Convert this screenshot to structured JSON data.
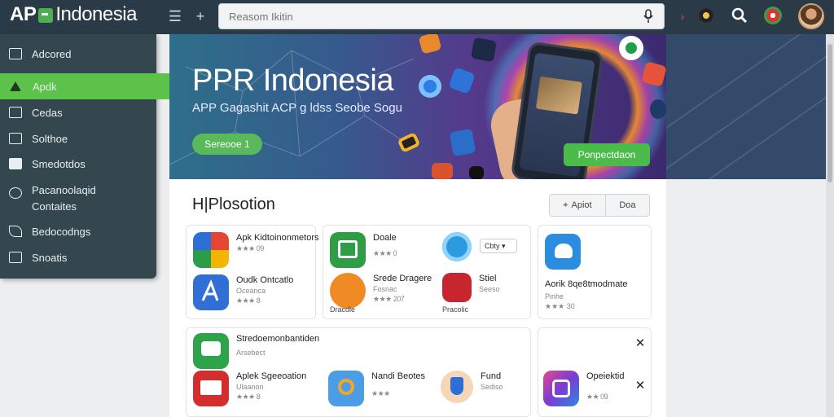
{
  "brand": {
    "prefix": "AP",
    "name": "Indonesia"
  },
  "search": {
    "placeholder": "Reasom Ikitin"
  },
  "sidebar": {
    "items": [
      {
        "label": "Adcored"
      },
      {
        "label": "Apdk"
      },
      {
        "label": "Cedas"
      },
      {
        "label": "Solthoe"
      },
      {
        "label": "Smedotdos"
      },
      {
        "label": "Pacanoolaqid Contaites"
      },
      {
        "label": "Bedocodngs"
      },
      {
        "label": "Snoatis"
      }
    ]
  },
  "banner": {
    "title": "PPR Indonesia",
    "subtitle": "APP Gagashit ACP g ldss Seobe Sogu",
    "left_button": "Sereooe 1",
    "right_button": "Ponpectdaon"
  },
  "content": {
    "title": "H|Plosotion",
    "seg_apply": "Apiot",
    "seg_other": "Doa"
  },
  "apps": [
    {
      "name": "Apk Kidtoinonmetors",
      "meta": "",
      "stars": "★★★ 09"
    },
    {
      "name": "Oudk Ontcatlo",
      "meta": "Oceanca",
      "stars": "★★★ 8"
    },
    {
      "name": "Doale",
      "meta": "",
      "stars": "★★★ 0"
    },
    {
      "name": "Srede Dragere",
      "meta": "Fosnac",
      "stars": "★★★ 207"
    },
    {
      "name": "Dracdle",
      "meta": "",
      "stars": ""
    },
    {
      "name": "Cbty",
      "meta": "",
      "stars": ""
    },
    {
      "name": "Stiel",
      "meta": "Seeso",
      "stars": ""
    },
    {
      "name": "Pracolic",
      "meta": "",
      "stars": ""
    },
    {
      "name": "Aorik 8qe8tmodmate",
      "meta": "Pinhe",
      "stars": "★★★ 30"
    },
    {
      "name": "Stredoemonbantiden",
      "meta": "Arsebect",
      "stars": ""
    },
    {
      "name": "Aplek Sgeeoation",
      "meta": "Ulaanon",
      "stars": "★★★ 8"
    },
    {
      "name": "Nandi Beotes",
      "meta": "",
      "stars": "★★★"
    },
    {
      "name": "Fund",
      "meta": "Sediso",
      "stars": ""
    },
    {
      "name": "Opeiektid",
      "meta": "",
      "stars": "★★ 09"
    }
  ],
  "colors": {
    "accent": "#5cc24a",
    "sidebar": "#34474f",
    "topbar": "#2b3a47"
  }
}
